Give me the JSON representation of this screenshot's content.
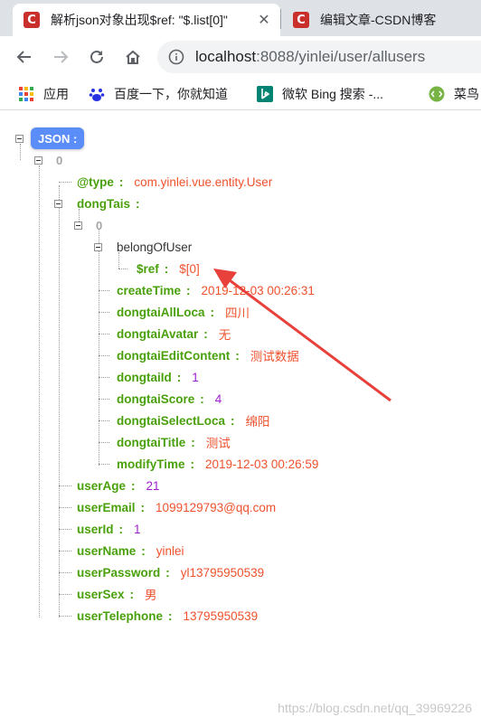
{
  "tabs": [
    {
      "favicon": "C",
      "title": "解析json对象出现$ref: \"$.list[0]\"",
      "close": "✕"
    },
    {
      "favicon": "C",
      "title": "编辑文章-CSDN博客"
    }
  ],
  "address": {
    "host": "localhost",
    "path": ":8088/yinlei/user/allusers"
  },
  "bookmarks": [
    {
      "icon": "apps-grid-icon",
      "label": "应用"
    },
    {
      "icon": "baidu-paw-icon",
      "label": "百度一下，你就知道"
    },
    {
      "icon": "bing-icon",
      "label": "微软 Bing 搜索 -..."
    },
    {
      "icon": "runoob-icon",
      "label": "菜鸟"
    }
  ],
  "json": {
    "root_label": "JSON :",
    "root_index": "0",
    "colon": ":",
    "type": {
      "key": "@type",
      "value": "com.yinlei.vue.entity.User"
    },
    "dongtais_key": "dongTais",
    "dongtai_index": "0",
    "belong_key": "belongOfUser",
    "ref": {
      "key": "$ref",
      "value": "$[0]"
    },
    "dongtai_fields": [
      {
        "key": "createTime",
        "value": "2019-12-03 00:26:31",
        "kind": "str"
      },
      {
        "key": "dongtaiAllLoca",
        "value": "四川",
        "kind": "str"
      },
      {
        "key": "dongtaiAvatar",
        "value": "无",
        "kind": "str"
      },
      {
        "key": "dongtaiEditContent",
        "value": "测试数据",
        "kind": "str"
      },
      {
        "key": "dongtaiId",
        "value": "1",
        "kind": "num"
      },
      {
        "key": "dongtaiScore",
        "value": "4",
        "kind": "num"
      },
      {
        "key": "dongtaiSelectLoca",
        "value": "绵阳",
        "kind": "str"
      },
      {
        "key": "dongtaiTitle",
        "value": "测试",
        "kind": "str"
      },
      {
        "key": "modifyTime",
        "value": "2019-12-03 00:26:59",
        "kind": "str"
      }
    ],
    "user_fields": [
      {
        "key": "userAge",
        "value": "21",
        "kind": "num"
      },
      {
        "key": "userEmail",
        "value": "1099129793@qq.com",
        "kind": "str"
      },
      {
        "key": "userId",
        "value": "1",
        "kind": "num"
      },
      {
        "key": "userName",
        "value": "yinlei",
        "kind": "str"
      },
      {
        "key": "userPassword",
        "value": "yl13795950539",
        "kind": "str"
      },
      {
        "key": "userSex",
        "value": "男",
        "kind": "str"
      },
      {
        "key": "userTelephone",
        "value": "13795950539",
        "kind": "num-str"
      }
    ]
  },
  "watermark": "https://blog.csdn.net/qq_39969226",
  "colors": {
    "key": "#49a00b",
    "string": "#f0512c",
    "number": "#a020d0",
    "badge": "#5a8df7",
    "arrow": "#e8403a"
  }
}
